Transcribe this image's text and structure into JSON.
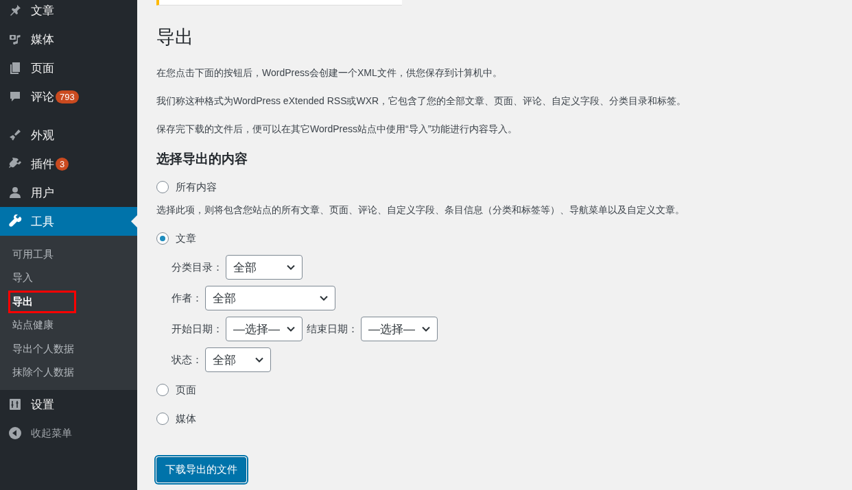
{
  "sidebar": {
    "groups": [
      [
        {
          "label": "文章",
          "selected": false
        },
        {
          "label": "媒体",
          "selected": false
        },
        {
          "label": "页面",
          "selected": false
        },
        {
          "label": "评论",
          "badge": "793",
          "selected": false
        }
      ],
      [
        {
          "label": "外观",
          "selected": false
        },
        {
          "label": "插件",
          "badge": "3",
          "selected": false
        },
        {
          "label": "用户",
          "selected": false
        },
        {
          "label": "工具",
          "selected": true,
          "submenu": [
            {
              "label": "可用工具",
              "selected": false,
              "highlighted": false
            },
            {
              "label": "导入",
              "selected": false,
              "highlighted": false
            },
            {
              "label": "导出",
              "selected": true,
              "highlighted": true
            },
            {
              "label": "站点健康",
              "selected": false,
              "highlighted": false
            },
            {
              "label": "导出个人数据",
              "selected": false,
              "highlighted": false
            },
            {
              "label": "抹除个人数据",
              "selected": false,
              "highlighted": false
            }
          ]
        },
        {
          "label": "设置",
          "selected": false
        }
      ]
    ],
    "collapse": "收起菜单"
  },
  "main": {
    "title": "导出",
    "paragraphs": [
      "在您点击下面的按钮后，WordPress会创建一个XML文件，供您保存到计算机中。",
      "我们称这种格式为WordPress eXtended RSS或WXR，它包含了您的全部文章、页面、评论、自定义字段、分类目录和标签。",
      "保存完下载的文件后，便可以在其它WordPress站点中使用“导入”功能进行内容导入。"
    ],
    "section_title": "选择导出的内容",
    "options": [
      {
        "label": "所有内容",
        "selected": false,
        "description": "选择此项，则将包含您站点的所有文章、页面、评论、自定义字段、条目信息（分类和标签等）、导航菜单以及自定义文章。"
      },
      {
        "label": "文章",
        "selected": true,
        "filters": [
          [
            {
              "label": "分类目录：",
              "value": "全部"
            }
          ],
          [
            {
              "label": "作者：",
              "value": "全部"
            }
          ],
          [
            {
              "label": "开始日期：",
              "value": "—选择—"
            },
            {
              "label": "结束日期：",
              "value": "—选择—"
            }
          ],
          [
            {
              "label": "状态：",
              "value": "全部"
            }
          ]
        ]
      },
      {
        "label": "页面",
        "selected": false
      },
      {
        "label": "媒体",
        "selected": false
      }
    ],
    "button": "下载导出的文件"
  }
}
